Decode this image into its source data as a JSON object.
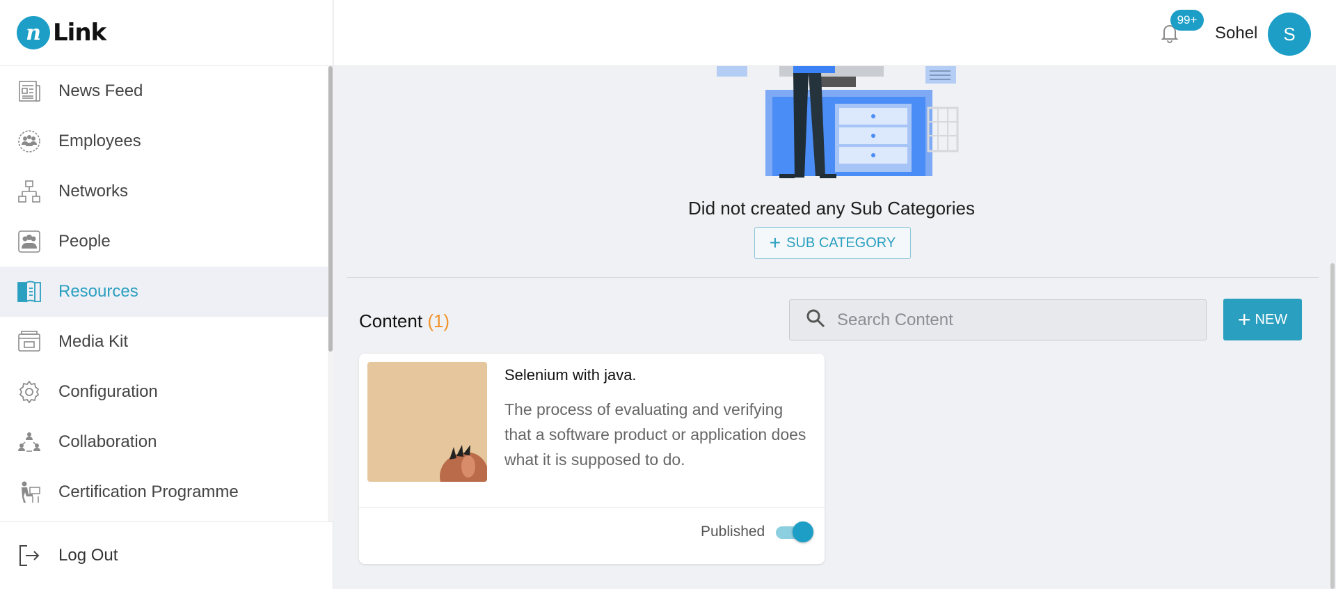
{
  "app": {
    "logo_text": "Link",
    "logo_mark": "n"
  },
  "header": {
    "notification_badge": "99+",
    "username": "Sohel",
    "avatar_initial": "S"
  },
  "sidebar": {
    "items": [
      {
        "label": "News Feed",
        "icon": "newspaper-icon"
      },
      {
        "label": "Employees",
        "icon": "employees-icon"
      },
      {
        "label": "Networks",
        "icon": "network-icon"
      },
      {
        "label": "People",
        "icon": "people-icon"
      },
      {
        "label": "Resources",
        "icon": "book-icon",
        "active": true
      },
      {
        "label": "Media Kit",
        "icon": "media-kit-icon"
      },
      {
        "label": "Configuration",
        "icon": "gear-icon"
      },
      {
        "label": "Collaboration",
        "icon": "collaboration-icon"
      },
      {
        "label": "Certification Programme",
        "icon": "certification-icon"
      }
    ],
    "logout_label": "Log Out"
  },
  "subcategories": {
    "empty_message": "Did not created any Sub Categories",
    "add_button_label": "SUB CATEGORY"
  },
  "content": {
    "title": "Content",
    "count": "(1)",
    "search_placeholder": "Search Content",
    "new_button_label": "NEW",
    "items": [
      {
        "title": "Selenium with java.",
        "description": "The process of evaluating and verifying that a software product or application does what it is supposed to do.",
        "status_label": "Published",
        "published": true
      }
    ]
  },
  "colors": {
    "accent": "#1c9ec6",
    "count": "#f0932b"
  }
}
